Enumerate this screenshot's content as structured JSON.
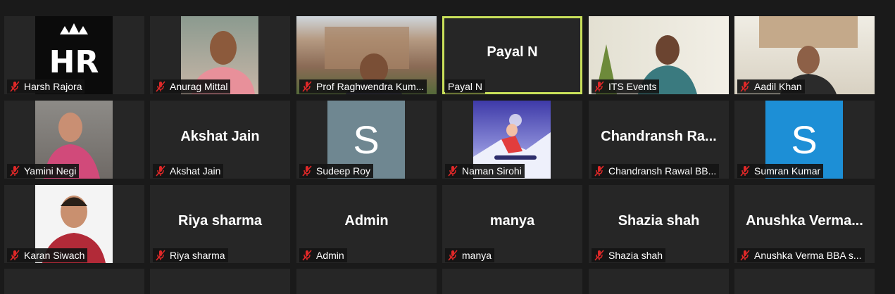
{
  "participants": [
    {
      "name": "Harsh Rajora",
      "type": "photo",
      "photo": "hr-logo"
    },
    {
      "name": "Anurag Mittal",
      "type": "photo",
      "photo": "man-pink-shirt"
    },
    {
      "name": "Prof Raghwendra Kum...",
      "type": "photo",
      "photo": "man-building"
    },
    {
      "name": "Payal N",
      "type": "name",
      "display": "Payal N",
      "active": true
    },
    {
      "name": "ITS Events",
      "type": "photo",
      "photo": "woman-plants"
    },
    {
      "name": "Aadil Khan",
      "type": "photo",
      "photo": "man-board"
    },
    {
      "name": "Yamini Negi",
      "type": "photo",
      "photo": "woman-pink"
    },
    {
      "name": "Akshat Jain",
      "type": "name",
      "display": "Akshat Jain"
    },
    {
      "name": "Sudeep Roy",
      "type": "avatar",
      "letter": "S",
      "color": "#6f8791"
    },
    {
      "name": "Naman Sirohi",
      "type": "photo",
      "photo": "snowboarder"
    },
    {
      "name": "Chandransh Rawal BB...",
      "type": "name",
      "display": "Chandransh  Ra..."
    },
    {
      "name": "Sumran Kumar",
      "type": "avatar",
      "letter": "S",
      "color": "#1d8fd6"
    },
    {
      "name": "Karan Siwach",
      "type": "photo",
      "photo": "man-portrait"
    },
    {
      "name": "Riya sharma",
      "type": "name",
      "display": "Riya sharma"
    },
    {
      "name": "Admin",
      "type": "name",
      "display": "Admin"
    },
    {
      "name": "manya",
      "type": "name",
      "display": "manya"
    },
    {
      "name": "Shazia shah",
      "type": "name",
      "display": "Shazia shah"
    },
    {
      "name": "Anushka Verma BBA s...",
      "type": "name",
      "display": "Anushka  Verma..."
    }
  ],
  "icons": {
    "muted": "mic-muted-icon"
  },
  "colors": {
    "active_border": "#c9e05a",
    "mute": "#e02828",
    "tile": "#262626",
    "background": "#1a1a1a"
  }
}
